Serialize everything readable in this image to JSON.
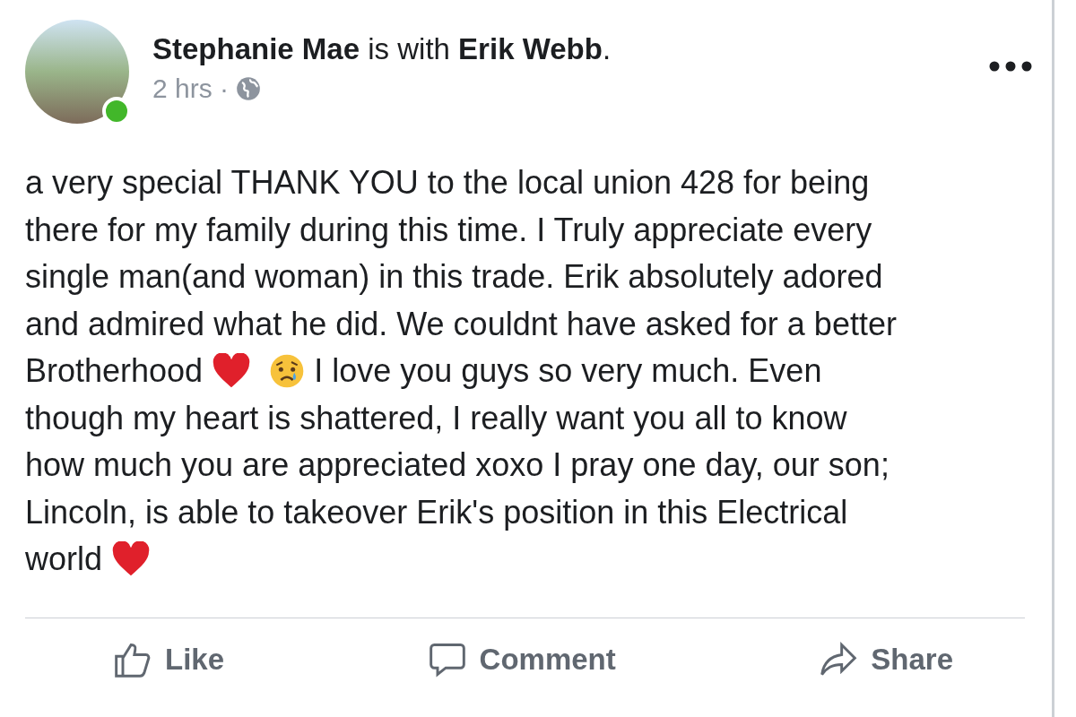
{
  "post": {
    "author_line": "**Stephanie Mae** is with **Erik Webb**.",
    "online": true,
    "time": "2 hrs ·",
    "body_lines": [
      [
        {
          "kind": "text",
          "text": "a very special THANK YOU to the local union 428 for being"
        }
      ],
      [
        {
          "kind": "text",
          "text": "there for my family during this time. I Truly appreciate every"
        }
      ],
      [
        {
          "kind": "text",
          "text": "single man(and woman) in this trade. Erik absolutely adored"
        }
      ],
      [
        {
          "kind": "text",
          "text": "and admired what he did. We couldnt have asked for a better"
        }
      ],
      [
        {
          "kind": "text",
          "text": "Brotherhood"
        },
        {
          "kind": "heart"
        },
        {
          "kind": "crying"
        },
        {
          "kind": "text",
          "text": "I love you guys so very much. Even"
        }
      ],
      [
        {
          "kind": "text",
          "text": "though my heart is shattered, I really want you all to know"
        }
      ],
      [
        {
          "kind": "text",
          "text": "how much you are appreciated xoxo I pray one day, our son;"
        }
      ],
      [
        {
          "kind": "text",
          "text": "Lincoln, is able to takeover Erik's position in this Electrical"
        }
      ],
      [
        {
          "kind": "text",
          "text": "world"
        },
        {
          "kind": "heart"
        }
      ]
    ],
    "actions": [
      {
        "kind": "like",
        "label": "Like"
      },
      {
        "kind": "comment",
        "label": "Comment"
      },
      {
        "kind": "share",
        "label": "Share"
      }
    ]
  }
}
